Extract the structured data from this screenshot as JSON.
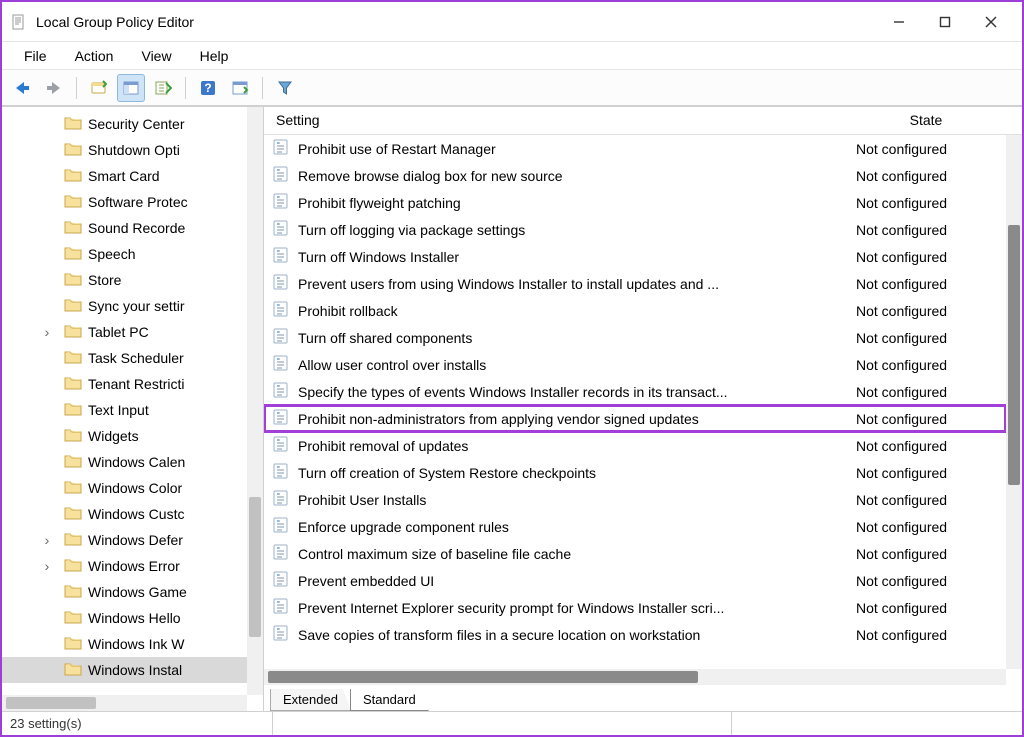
{
  "window": {
    "title": "Local Group Policy Editor"
  },
  "menu": {
    "file": "File",
    "action": "Action",
    "view": "View",
    "help": "Help"
  },
  "columns": {
    "setting": "Setting",
    "state": "State"
  },
  "tree": {
    "items": [
      {
        "label": "Security Center",
        "expandable": false
      },
      {
        "label": "Shutdown Opti",
        "expandable": false
      },
      {
        "label": "Smart Card",
        "expandable": false
      },
      {
        "label": "Software Protec",
        "expandable": false
      },
      {
        "label": "Sound Recorde",
        "expandable": false
      },
      {
        "label": "Speech",
        "expandable": false
      },
      {
        "label": "Store",
        "expandable": false
      },
      {
        "label": "Sync your settir",
        "expandable": false
      },
      {
        "label": "Tablet PC",
        "expandable": true
      },
      {
        "label": "Task Scheduler",
        "expandable": false
      },
      {
        "label": "Tenant Restricti",
        "expandable": false
      },
      {
        "label": "Text Input",
        "expandable": false
      },
      {
        "label": "Widgets",
        "expandable": false
      },
      {
        "label": "Windows Calen",
        "expandable": false
      },
      {
        "label": "Windows Color",
        "expandable": false
      },
      {
        "label": "Windows Custc",
        "expandable": false
      },
      {
        "label": "Windows Defer",
        "expandable": true
      },
      {
        "label": "Windows Error",
        "expandable": true
      },
      {
        "label": "Windows Game",
        "expandable": false
      },
      {
        "label": "Windows Hello",
        "expandable": false
      },
      {
        "label": "Windows Ink W",
        "expandable": false
      },
      {
        "label": "Windows Instal",
        "expandable": false,
        "selected": true
      }
    ]
  },
  "settings": [
    {
      "name": "Prohibit use of Restart Manager",
      "state": "Not configured"
    },
    {
      "name": "Remove browse dialog box for new source",
      "state": "Not configured"
    },
    {
      "name": "Prohibit flyweight patching",
      "state": "Not configured"
    },
    {
      "name": "Turn off logging via package settings",
      "state": "Not configured"
    },
    {
      "name": "Turn off Windows Installer",
      "state": "Not configured"
    },
    {
      "name": "Prevent users from using Windows Installer to install updates and ...",
      "state": "Not configured"
    },
    {
      "name": "Prohibit rollback",
      "state": "Not configured"
    },
    {
      "name": "Turn off shared components",
      "state": "Not configured"
    },
    {
      "name": "Allow user control over installs",
      "state": "Not configured"
    },
    {
      "name": "Specify the types of events Windows Installer records in its transact...",
      "state": "Not configured"
    },
    {
      "name": "Prohibit non-administrators from applying vendor signed updates",
      "state": "Not configured",
      "highlight": true
    },
    {
      "name": "Prohibit removal of updates",
      "state": "Not configured"
    },
    {
      "name": "Turn off creation of System Restore checkpoints",
      "state": "Not configured"
    },
    {
      "name": "Prohibit User Installs",
      "state": "Not configured"
    },
    {
      "name": "Enforce upgrade component rules",
      "state": "Not configured"
    },
    {
      "name": "Control maximum size of baseline file cache",
      "state": "Not configured"
    },
    {
      "name": "Prevent embedded UI",
      "state": "Not configured"
    },
    {
      "name": "Prevent Internet Explorer security prompt for Windows Installer scri...",
      "state": "Not configured"
    },
    {
      "name": "Save copies of transform files in a secure location on workstation",
      "state": "Not configured"
    }
  ],
  "tabs": {
    "extended": "Extended",
    "standard": "Standard"
  },
  "status": {
    "text": "23 setting(s)"
  }
}
